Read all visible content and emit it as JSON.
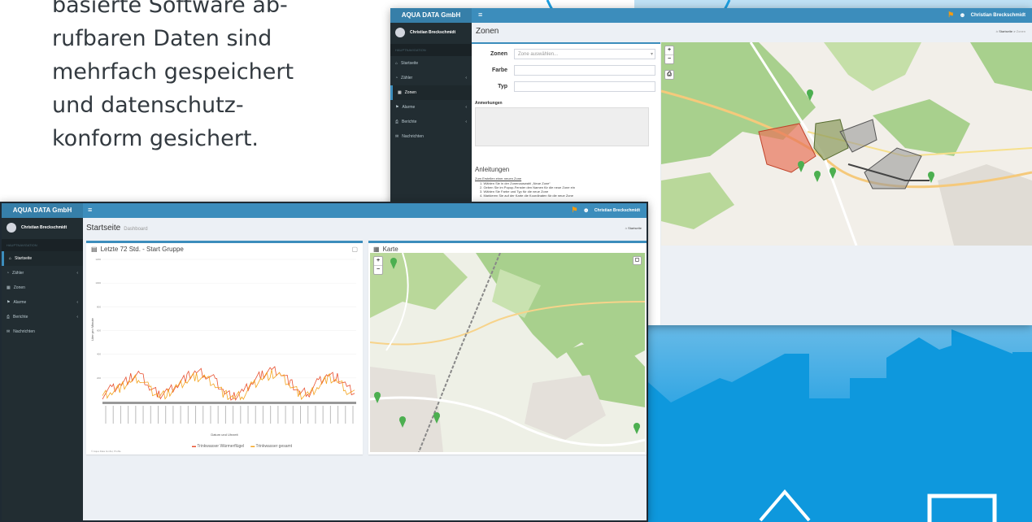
{
  "promo": {
    "lines": [
      "basierte Software ab-",
      "rufbaren Daten sind",
      "mehrfach gespeichert",
      "und datenschutz-",
      "konform gesichert."
    ]
  },
  "app": {
    "brand": "AQUA DATA GmbH",
    "user": "Christian Breckschmidt",
    "nav_header": "HAUPTNAVIGATION",
    "nav": [
      {
        "label": "Startseite",
        "icon": "home-icon"
      },
      {
        "label": "Zähler",
        "icon": "counter-icon"
      },
      {
        "label": "Zonen",
        "icon": "map-icon"
      },
      {
        "label": "Alarme",
        "icon": "bell-icon"
      },
      {
        "label": "Berichte",
        "icon": "print-icon"
      },
      {
        "label": "Nachrichten",
        "icon": "envelope-icon"
      }
    ]
  },
  "zones_window": {
    "title": "Zonen",
    "breadcrumb_home": "Startseite",
    "breadcrumb_current": "Zonen",
    "form": {
      "zone_label": "Zonen",
      "zone_placeholder": "Zone auswählen...",
      "color_label": "Farbe",
      "type_label": "Typ",
      "notes_label": "Anmerkungen"
    },
    "instructions": {
      "title": "Anleitungen",
      "subtitle": "Zum Erstellen einer neuen Zone",
      "steps": [
        "1. Wählen Sie in der Zonenauswahl „Neue Zone“",
        "2. Geben Sie im Popup-Fenster den Namen für die neue Zone ein",
        "3. Wählen Sie Farbe und Typ für die neue Zone",
        "4. Markieren Sie auf der Karte die Koordinaten für die neue Zone"
      ]
    }
  },
  "home_window": {
    "title": "Startseite",
    "subtitle": "Dashboard",
    "breadcrumb": "Startseite",
    "chart_box_title": "Letzte 72 Std. - Start Gruppe",
    "map_box_title": "Karte",
    "ylabel": "Liter pro Minute",
    "xlabel": "Datum und Uhrzeit",
    "legend": [
      "Trinkwasser Wärmerflügel",
      "Trinkwasser gesamt"
    ],
    "footer": "© Aqua Data GmbH, Profile"
  },
  "colors": {
    "header": "#3c8dbc",
    "brand": "#367fa9",
    "sidebar": "#222d32",
    "series_a": "#e8502f",
    "series_b": "#f4a41f",
    "marker": "#4caf50"
  },
  "chart_data": {
    "type": "line",
    "title": "Letzte 72 Std. - Start Gruppe",
    "xlabel": "Datum und Uhrzeit",
    "ylabel": "Liter pro Minute",
    "ylim": [
      0,
      1200
    ],
    "yticks": [
      200,
      400,
      600,
      800,
      1000,
      1200
    ],
    "series": [
      {
        "name": "Trinkwasser Wärmerflügel",
        "values": [
          60,
          110,
          150,
          200,
          230,
          120,
          60,
          90,
          150,
          210,
          250,
          230,
          180,
          80,
          40,
          80,
          170,
          230,
          270,
          250,
          160,
          70,
          80,
          170,
          230,
          200,
          120,
          60
        ]
      },
      {
        "name": "Trinkwasser gesamt",
        "values": [
          50,
          90,
          120,
          170,
          200,
          110,
          50,
          70,
          120,
          180,
          210,
          200,
          150,
          60,
          30,
          60,
          140,
          200,
          230,
          210,
          140,
          60,
          60,
          140,
          200,
          170,
          100,
          50
        ]
      }
    ]
  }
}
